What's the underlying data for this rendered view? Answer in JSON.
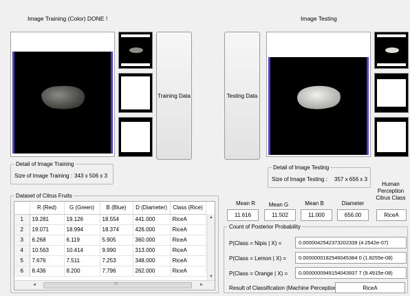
{
  "training": {
    "title": "Image Training (Color) DONE !",
    "button_label": "Training Data",
    "detail_legend": "Detail of Image Training",
    "size_label": "Size of Image Training :",
    "size_value": "343 x 506 x 3"
  },
  "testing": {
    "title": "Image Testing",
    "button_label": "Testing Data",
    "detail_legend": "Detail of Image Testing",
    "size_label": "Size of Image Testing :",
    "size_value": "357 x 656 x 3"
  },
  "dataset": {
    "legend": "Dataset of Citrus Fruits",
    "columns": [
      "R (Red)",
      "G (Green)",
      "B (Blue)",
      "D (Diameter)",
      "Class (Rice)"
    ],
    "rows": [
      {
        "n": "1",
        "r": "19.281",
        "g": "19.126",
        "b": "18.554",
        "d": "441.000",
        "c": "RiceA"
      },
      {
        "n": "2",
        "r": "19.071",
        "g": "18.994",
        "b": "18.374",
        "d": "426.000",
        "c": "RiceA"
      },
      {
        "n": "3",
        "r": "6.268",
        "g": "6.119",
        "b": "5.905",
        "d": "360.000",
        "c": "RiceA"
      },
      {
        "n": "4",
        "r": "10.563",
        "g": "10.414",
        "b": "9.990",
        "d": "313.000",
        "c": "RiceA"
      },
      {
        "n": "5",
        "r": "7.676",
        "g": "7.511",
        "b": "7.253",
        "d": "348.000",
        "c": "RiceA"
      },
      {
        "n": "6",
        "r": "8.436",
        "g": "8.200",
        "b": "7.796",
        "d": "262.000",
        "c": "RiceA"
      }
    ],
    "scroll_mid": "III"
  },
  "features": {
    "mean_r_label": "Mean R",
    "mean_r": "11.616",
    "mean_g_label": "Mean G",
    "mean_g": "11.502",
    "mean_b_label": "Mean B",
    "mean_b": "11.000",
    "diameter_label": "Diameter",
    "diameter": "656.00",
    "human_label": "Human Perception Citrus Class",
    "human_value": "RiceA"
  },
  "posterior": {
    "legend": "Count of  Posterior Probability",
    "rows": [
      {
        "label": "P(Class = Nipis | X) =",
        "value": "0.0000042542373202339  (4.2542e-07)"
      },
      {
        "label": "P(Class = Lemon | X) =",
        "value": "0.0000000182546045384 0  (1.8255e-08)"
      },
      {
        "label": "P(Class = Orange | X) =",
        "value": "0.0000000949154043937 7  (9.4915e-08)"
      }
    ],
    "result_label": "Result of Classification (Machine Perception) :",
    "result_value": "RiceA"
  },
  "icons": {
    "scroll_up": "▲",
    "scroll_down": "▼",
    "scroll_left": "◄",
    "scroll_right": "►"
  },
  "colors": {
    "image_edge": "#4a40c0",
    "background": "#f0f0f0"
  }
}
